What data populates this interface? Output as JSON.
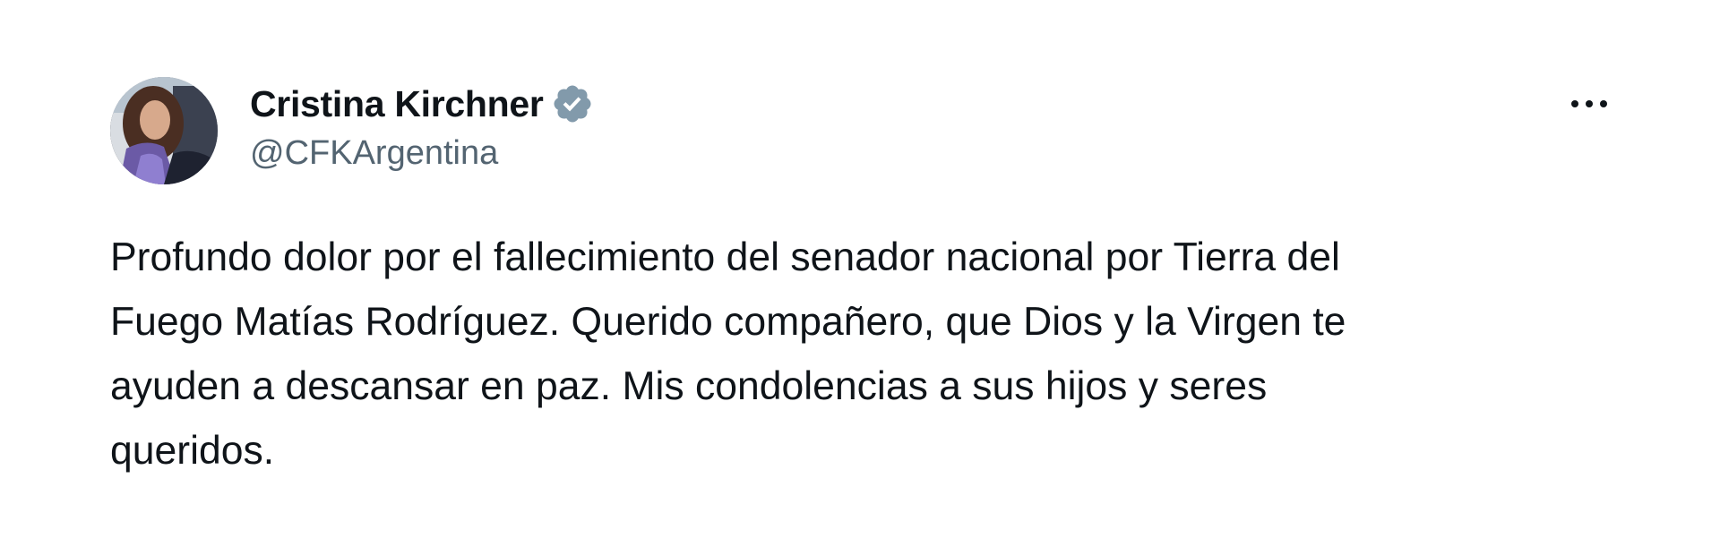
{
  "author": {
    "display_name": "Cristina Kirchner",
    "handle": "@CFKArgentina",
    "verified_icon": "verified-badge-icon",
    "avatar_icon": "avatar"
  },
  "menu": {
    "icon": "more-options-icon"
  },
  "tweet": {
    "lines": [
      "Profundo dolor por el fallecimiento del senador nacional por Tierra del",
      "Fuego Matías Rodríguez. Querido compañero, que Dios y la Virgen te",
      "ayuden a descansar en paz. Mis condolencias a sus hijos y seres",
      "queridos."
    ]
  },
  "colors": {
    "text": "#0f1419",
    "secondary": "#536471",
    "verified_badge": "#829aab",
    "background": "#ffffff"
  }
}
